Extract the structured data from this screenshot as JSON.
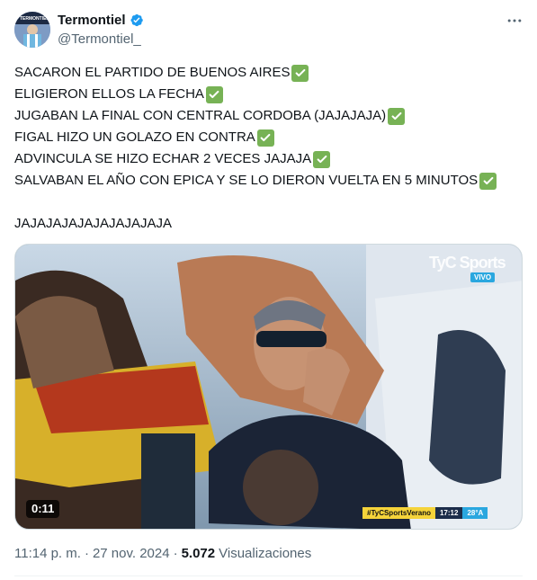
{
  "author": {
    "display_name": "Termontiel",
    "handle": "@Termontiel_",
    "verified": true,
    "avatar_icon": "avatar-image",
    "verified_icon": "verified-badge-icon",
    "verified_color": "#1d9bf0"
  },
  "more_icon": "more-options-icon",
  "tweet": {
    "lines": [
      {
        "text": "SACARON EL PARTIDO DE BUENOS AIRES",
        "check": true
      },
      {
        "text": "ELIGIERON ELLOS LA FECHA",
        "check": true
      },
      {
        "text": "JUGABAN LA FINAL CON CENTRAL CORDOBA (JAJAJAJA)",
        "check": true
      },
      {
        "text": "FIGAL HIZO UN GOLAZO EN CONTRA",
        "check": true
      },
      {
        "text": "ADVINCULA SE HIZO ECHAR 2 VECES JAJAJA",
        "check": true
      },
      {
        "text": "SALVABAN EL AÑO CON EPICA Y SE LO DIERON VUELTA EN 5 MINUTOS",
        "check": true
      }
    ],
    "closing": "JAJAJAJAJAJAJAJAJAJA",
    "check_icon": "check-mark-emoji-icon",
    "check_color": "#77b255"
  },
  "media": {
    "type": "video",
    "duration": "0:11",
    "broadcaster_logo": "TyC Sports",
    "live_badge": "VIVO",
    "ticker_tag": "#TyCSportsVerano",
    "ticker_clock": "17:12",
    "ticker_temp": "28°A"
  },
  "meta": {
    "time": "11:14 p. m.",
    "separator": "·",
    "date": "27 nov. 2024",
    "views_count": "5.072",
    "views_label": "Visualizaciones"
  }
}
